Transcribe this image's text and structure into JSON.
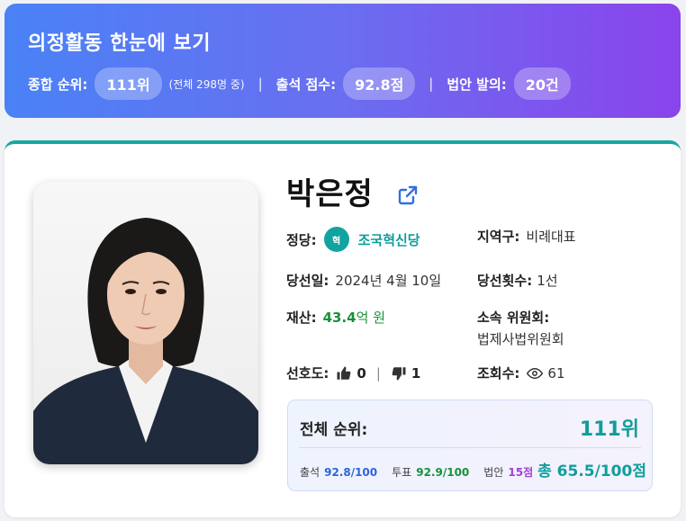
{
  "banner": {
    "title": "의정활동 한눈에 보기",
    "overall_rank_label": "종합 순위:",
    "overall_rank_value": "111위",
    "overall_rank_note": "(전체 298명 중)",
    "separator": "|",
    "attendance_label": "출석 점수:",
    "attendance_value": "92.8점",
    "bills_label": "법안 발의:",
    "bills_value": "20건"
  },
  "profile": {
    "name": "박은정",
    "party_label": "정당:",
    "party_logo_text": "혁",
    "party_name": "조국혁신당",
    "district_label": "지역구:",
    "district_value": "비례대표",
    "elected_date_label": "당선일:",
    "elected_date_value": "2024년 4월 10일",
    "term_count_label": "당선횟수:",
    "term_count_value": "1선",
    "assets_label": "재산:",
    "assets_amount": "43.4",
    "assets_unit": "억 원",
    "committee_label": "소속 위원회:",
    "committee_value": "법제사법위원회",
    "preference_label": "선호도:",
    "likes": "0",
    "dislikes": "1",
    "pref_separator": "|",
    "views_label": "조회수:",
    "views": "61"
  },
  "rank_box": {
    "label": "전체 순위:",
    "value": "111위",
    "attendance_label": "출석",
    "attendance_value": "92.8/100",
    "vote_label": "투표",
    "vote_value": "92.9/100",
    "bills_label": "법안",
    "bills_value": "15점",
    "total_value": "총 65.5/100점"
  },
  "colors": {
    "banner_gradient_start": "#4a82f6",
    "banner_gradient_end": "#8a44ec",
    "accent_teal": "#0f9e9b",
    "assets_green": "#17913a",
    "attendance_blue": "#2f63d8",
    "bills_purple": "#a23fd8",
    "link_icon_blue": "#2f6fe0"
  },
  "icons": {
    "external_link": "external-link-icon",
    "thumbs_up": "thumbs-up-icon",
    "thumbs_down": "thumbs-down-icon",
    "views": "eye-icon"
  }
}
